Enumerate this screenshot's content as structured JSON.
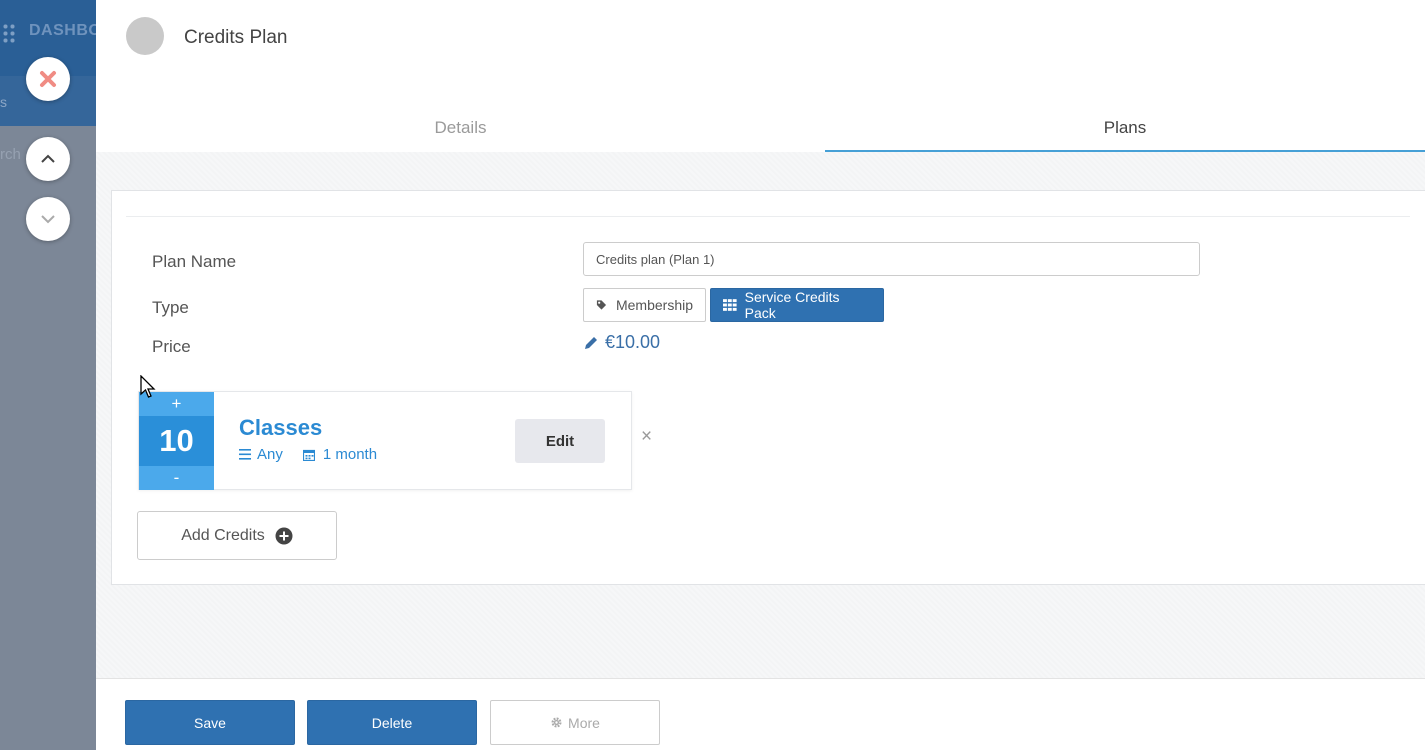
{
  "background_app": {
    "brand": "DASHBOARD",
    "nav_label": "s",
    "search_label": "rch"
  },
  "header": {
    "title": "Credits Plan"
  },
  "tabs": [
    {
      "label": "Details",
      "active": false
    },
    {
      "label": "Plans",
      "active": true
    }
  ],
  "form": {
    "plan_name_label": "Plan Name",
    "plan_name_value": "Credits plan (Plan 1)",
    "type_label": "Type",
    "type_options": [
      "Membership",
      "Service Credits Pack"
    ],
    "type_selected": "Service Credits Pack",
    "price_label": "Price",
    "price_value": "€10.00"
  },
  "credit_item": {
    "plus": "+",
    "count": "10",
    "minus": "-",
    "name": "Classes",
    "scope": "Any",
    "duration": "1 month",
    "edit_label": "Edit",
    "remove_label": "×"
  },
  "add_credits_label": "Add Credits",
  "footer": {
    "save_label": "Save",
    "delete_label": "Delete",
    "more_label": "More"
  },
  "colors": {
    "primary": "#2f71b1",
    "accent": "#2b8ad3",
    "tab_underline": "#46a0d6",
    "counter_bg": "#2a8fd9",
    "close_icon": "#f08c84"
  }
}
